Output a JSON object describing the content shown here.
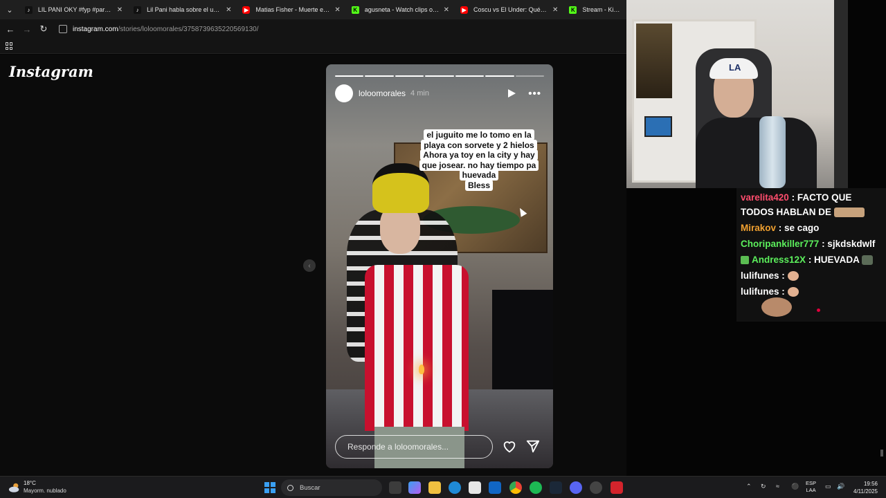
{
  "browser": {
    "tabs": [
      {
        "label": "LIL PANI OKY #fyp #parati #oky",
        "favicon": "tiktok-icon"
      },
      {
        "label": "Lil Pani habla sobre el under _",
        "favicon": "tiktok-icon"
      },
      {
        "label": "Matias Fisher - Muerte en Hallo",
        "favicon": "youtube-icon"
      },
      {
        "label": "agusneta - Watch clips on Kick",
        "favicon": "kick-icon"
      },
      {
        "label": "Coscu vs El Under: Qué CARAJO",
        "favicon": "youtube-icon"
      },
      {
        "label": "Stream - Kick Dash",
        "favicon": "kick-icon"
      }
    ],
    "url_host": "instagram.com",
    "url_path": "/stories/loloomorales/3758739635220569130/"
  },
  "instagram": {
    "logo": "Instagram",
    "story": {
      "username": "loloomorales",
      "time": "4 min",
      "progress_total": 7,
      "progress_done": 6,
      "caption_lines": [
        "el juguito me lo tomo en la",
        "playa con sorvete y 2 hielos",
        "Ahora ya toy en la city y hay",
        "que josear. no hay tiempo pa",
        "huevada",
        "Bless"
      ],
      "reply_placeholder": "Responde a loloomorales..."
    }
  },
  "chat": {
    "messages": [
      {
        "user": "varelita420",
        "color": "#ff4d6d",
        "text": ": FACTO QUE TODOS HABLAN DE"
      },
      {
        "user": "Mirakov",
        "color": "#f0a030",
        "text": ": se cago"
      },
      {
        "user": "Choripankiller777",
        "color": "#5cf05c",
        "text": ": sjkdskdwlf"
      },
      {
        "user": "Andress12X",
        "color": "#5cf05c",
        "text": ": HUEVADA"
      },
      {
        "user": "lulifunes",
        "color": "#ffffff",
        "text": ":"
      },
      {
        "user": "lulifunes",
        "color": "#ffffff",
        "text": ":"
      }
    ]
  },
  "webcam": {
    "cap_logo": "LA"
  },
  "taskbar": {
    "weather_temp": "18°C",
    "weather_desc": "Mayorm. nublado",
    "search_label": "Buscar",
    "lang_top": "ESP",
    "lang_bottom": "LAA",
    "time": "19:56",
    "date": "4/11/2025"
  }
}
